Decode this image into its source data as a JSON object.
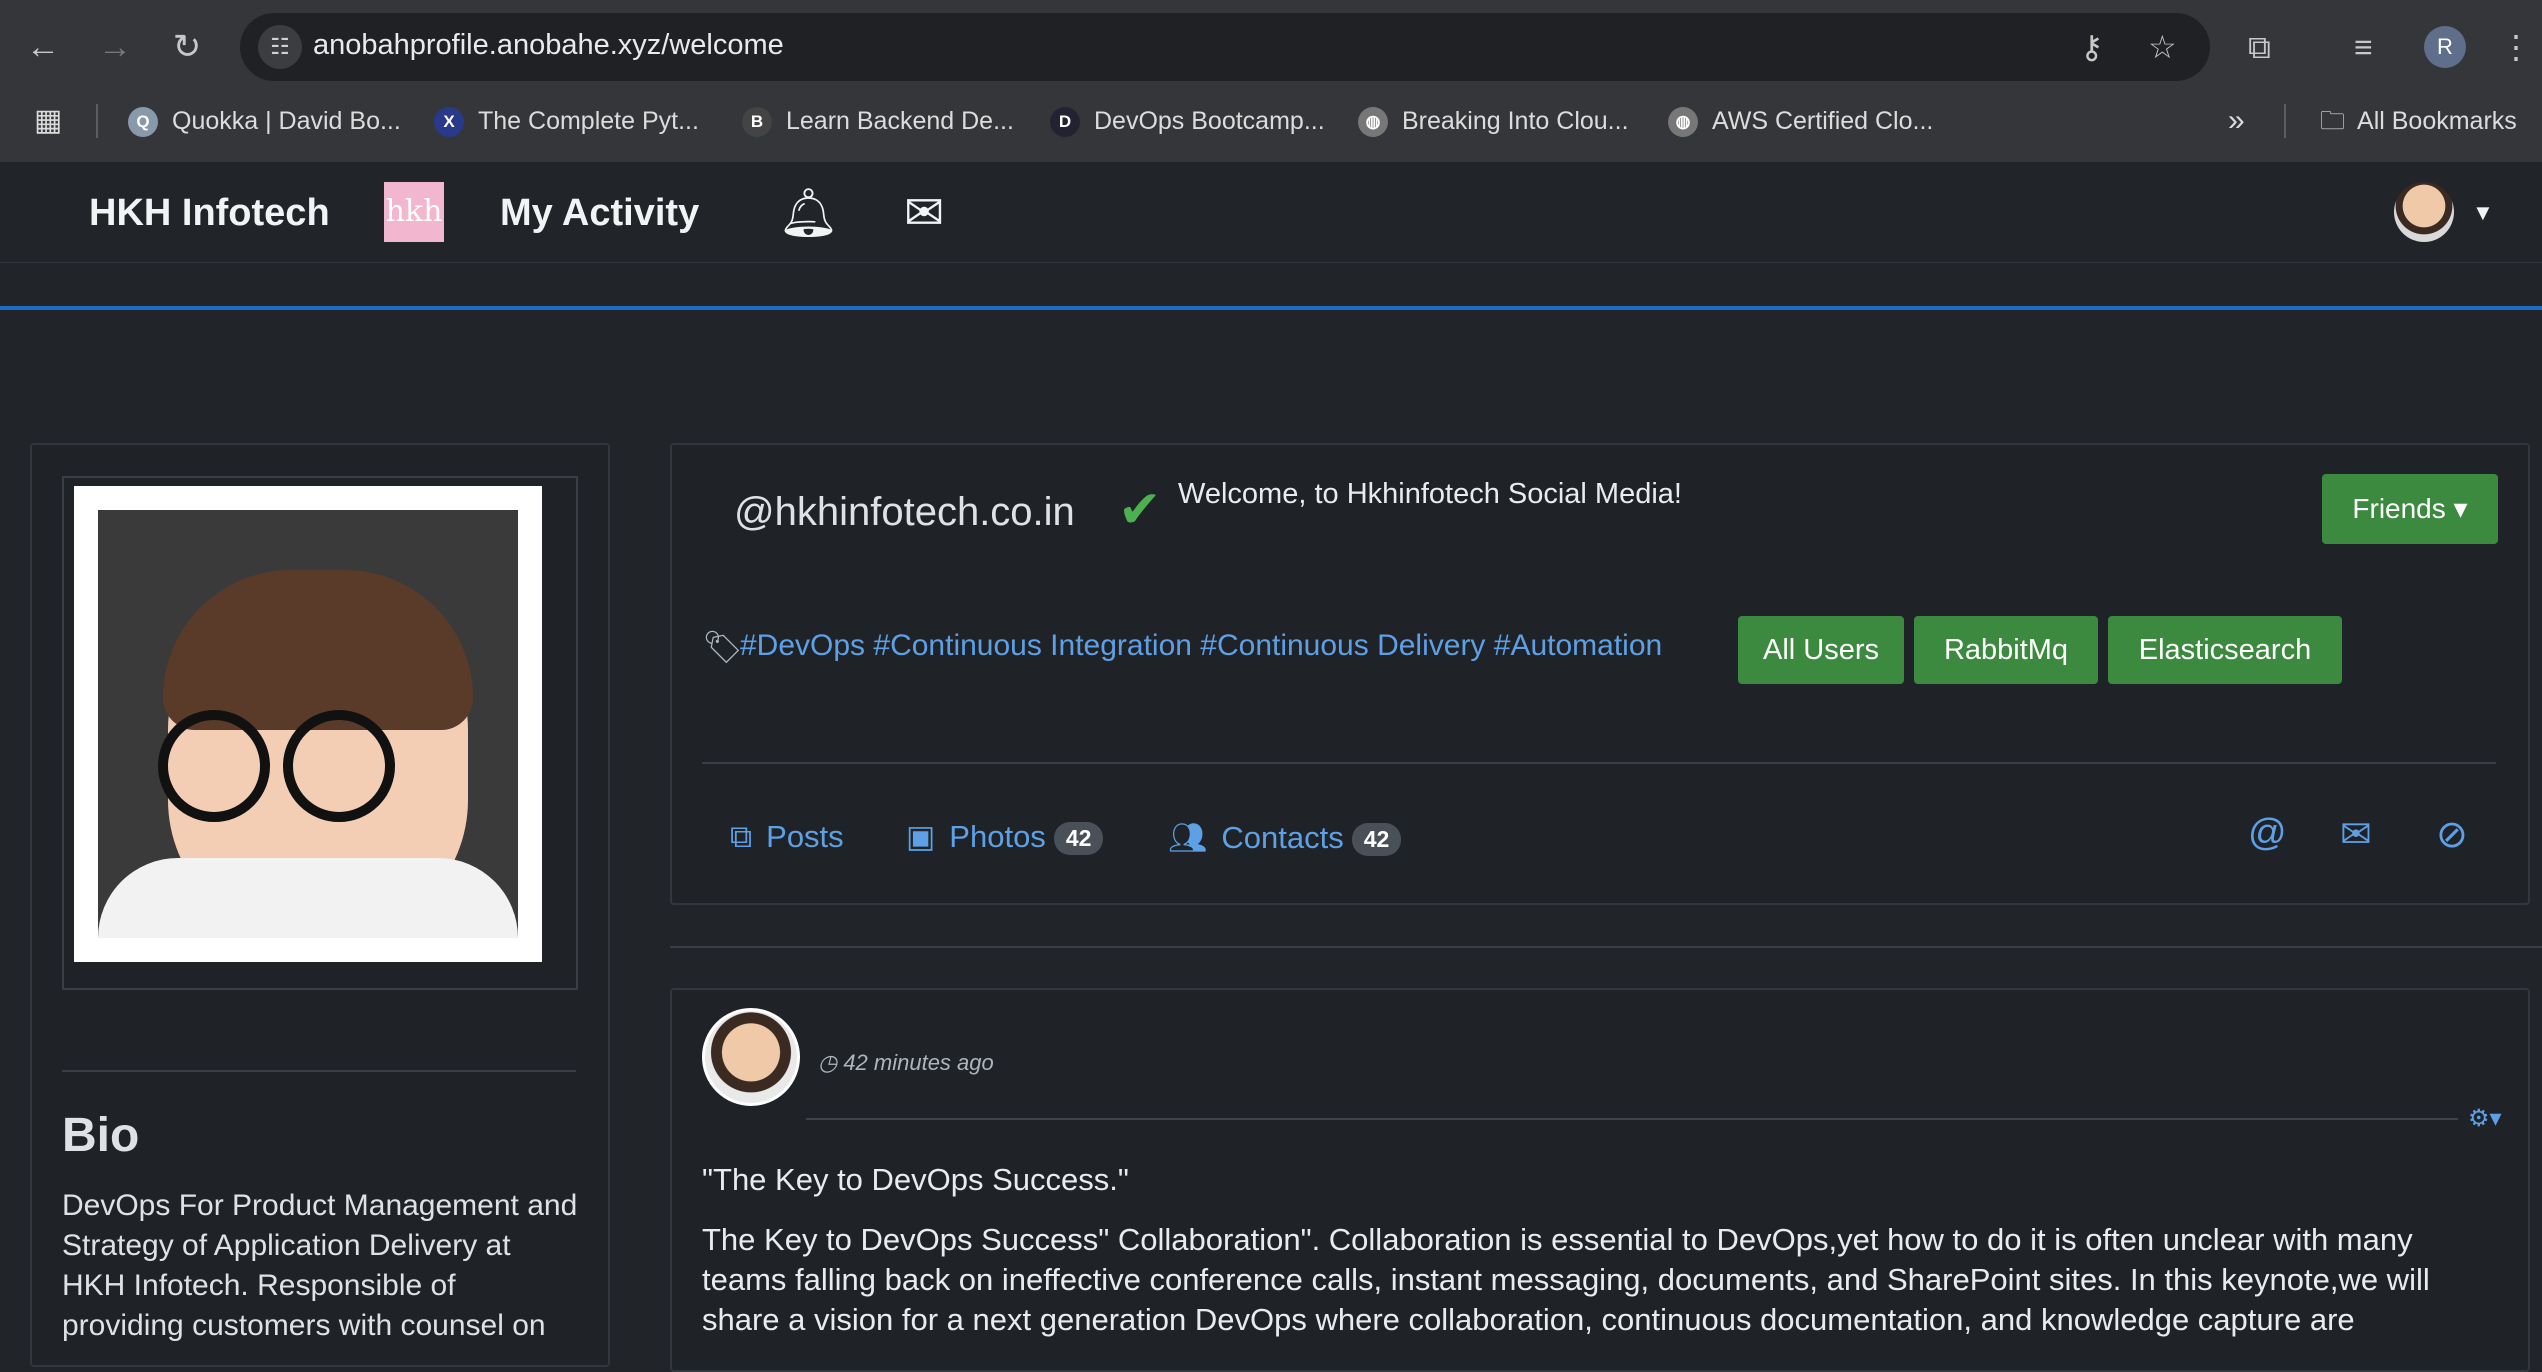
{
  "browser": {
    "url": "anobahprofile.anobahe.xyz/welcome",
    "profile_initial": "R",
    "bookmarks": [
      {
        "label": "Quokka | David Bo..."
      },
      {
        "label": "The Complete Pyt..."
      },
      {
        "label": "Learn Backend De..."
      },
      {
        "label": "DevOps Bootcamp..."
      },
      {
        "label": "Breaking Into Clou..."
      },
      {
        "label": "AWS Certified Clo..."
      }
    ],
    "more": "»",
    "all_bookmarks": "All Bookmarks"
  },
  "nav": {
    "brand": "HKH Infotech",
    "logo_text": "hkh",
    "activity": "My Activity"
  },
  "profile": {
    "bio_title": "Bio",
    "bio_text": "DevOps For Product Management and Strategy of Application Delivery at HKH Infotech. Responsible of providing customers with counsel on"
  },
  "header": {
    "handle": "@hkhinfotech.co.in",
    "welcome": "Welcome, to Hkhinfotech Social Media!",
    "friends_button": "Friends ▾",
    "tags": "#DevOps #Continuous Integration #Continuous Delivery #Automation",
    "tag_buttons": [
      "All Users",
      "RabbitMq",
      "Elasticsearch"
    ]
  },
  "tabs": {
    "posts": "Posts",
    "photos": "Photos",
    "photos_count": "42",
    "contacts": "Contacts",
    "contacts_count": "42"
  },
  "post": {
    "time": "42 minutes ago",
    "title": "\"The Key to DevOps Success.\"",
    "body": "The Key to DevOps Success\" Collaboration\". Collaboration is essential to DevOps,yet how to do it is often unclear with many teams falling back on ineffective conference calls, instant messaging, documents, and SharePoint sites. In this keynote,we will share a vision for a next generation DevOps where collaboration, continuous documentation, and knowledge capture are"
  }
}
